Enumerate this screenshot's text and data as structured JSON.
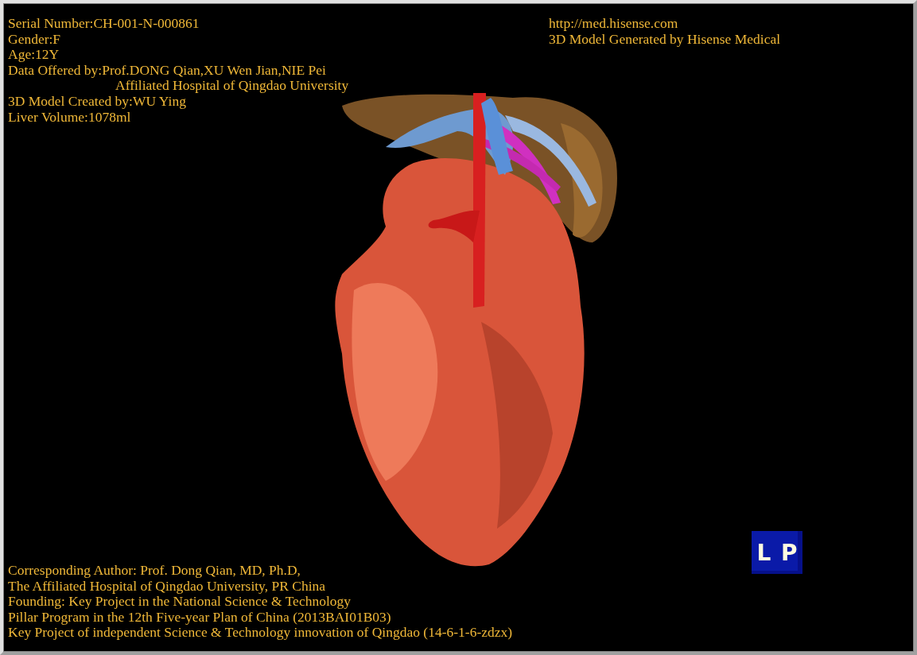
{
  "info_top_left": [
    {
      "kind": "line",
      "text": "Serial Number:CH-001-N-000861"
    },
    {
      "kind": "line",
      "text": "Gender:F"
    },
    {
      "kind": "line",
      "text": "Age:12Y"
    },
    {
      "kind": "line",
      "text": "Data Offered by:Prof.DONG Qian,XU Wen Jian,NIE Pei"
    },
    {
      "kind": "continuation",
      "text": "Affiliated Hospital of Qingdao University"
    },
    {
      "kind": "line",
      "text": "3D Model Created by:WU Ying"
    },
    {
      "kind": "line",
      "text": "Liver Volume:1078ml"
    }
  ],
  "info_top_right": [
    "http://med.hisense.com",
    "3D Model Generated by Hisense Medical"
  ],
  "info_bottom": [
    "Corresponding Author: Prof. Dong Qian, MD, Ph.D,",
    "The Affiliated Hospital of Qingdao University, PR China",
    "Founding: Key Project in the National Science & Technology",
    "Pillar Program in the 12th Five-year Plan of China (2013BAI01B03)",
    "Key Project of independent Science & Technology innovation of Qingdao (14-6-1-6-zdzx)"
  ],
  "orientation_cube": {
    "labels": [
      "L",
      "P"
    ]
  }
}
